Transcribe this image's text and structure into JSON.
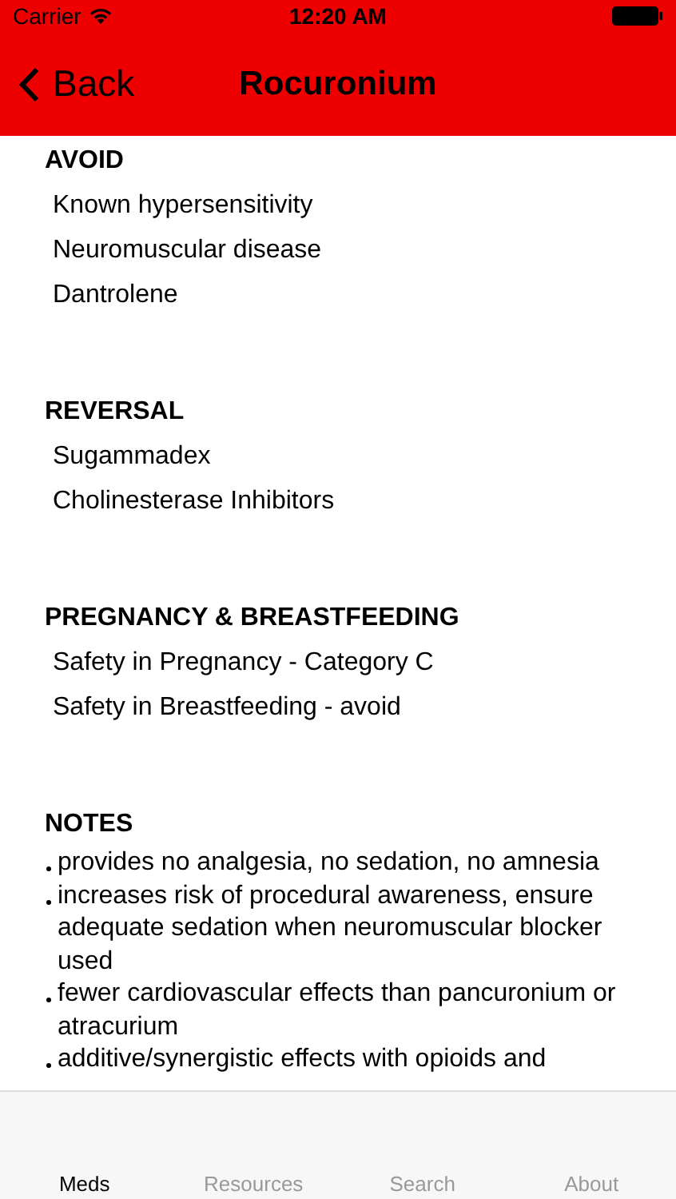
{
  "status_bar": {
    "carrier": "Carrier",
    "time": "12:20 AM"
  },
  "nav_bar": {
    "back": "Back",
    "title": "Rocuronium"
  },
  "sections": [
    {
      "heading": "AVOID",
      "kind": "plain",
      "items": [
        "Known hypersensitivity",
        "Neuromuscular disease",
        "Dantrolene"
      ]
    },
    {
      "heading": "REVERSAL",
      "kind": "plain",
      "items": [
        "Sugammadex",
        "Cholinesterase Inhibitors"
      ]
    },
    {
      "heading": "PREGNANCY & BREASTFEEDING",
      "kind": "plain",
      "items": [
        "Safety in Pregnancy - Category C",
        "Safety in Breastfeeding - avoid"
      ]
    },
    {
      "heading": "NOTES",
      "kind": "bullets",
      "items": [
        "provides no analgesia, no sedation, no amnesia",
        "increases risk of procedural awareness, ensure adequate sedation when neuromuscular blocker used",
        "fewer cardiovascular effects than pancuronium or atracurium",
        "additive/synergistic effects with opioids and"
      ]
    }
  ],
  "tabs": [
    {
      "label": "Meds",
      "selected": true
    },
    {
      "label": "Resources",
      "selected": false
    },
    {
      "label": "Search",
      "selected": false
    },
    {
      "label": "About",
      "selected": false
    }
  ]
}
